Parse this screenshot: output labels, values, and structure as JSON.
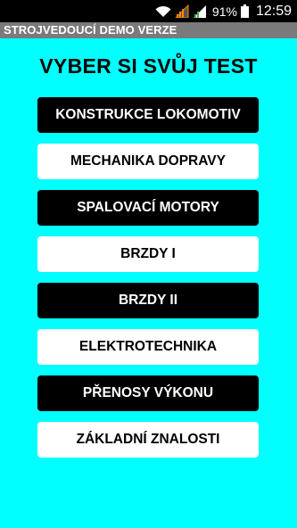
{
  "status_bar": {
    "battery_percent": "91%",
    "time": "12:59",
    "icons": [
      "wifi-icon",
      "signal-icon",
      "signal-icon",
      "battery-icon"
    ]
  },
  "app": {
    "title": "STROJVEDOUCÍ DEMO VERZE"
  },
  "main": {
    "heading": "VYBER SI SVŮJ TEST",
    "tests": [
      {
        "label": "KONSTRUKCE LOKOMOTIV",
        "style": "dark"
      },
      {
        "label": "MECHANIKA DOPRAVY",
        "style": "light"
      },
      {
        "label": "SPALOVACÍ MOTORY",
        "style": "dark"
      },
      {
        "label": "BRZDY I",
        "style": "light"
      },
      {
        "label": "BRZDY II",
        "style": "dark"
      },
      {
        "label": "ELEKTROTECHNIKA",
        "style": "light"
      },
      {
        "label": "PŘENOSY VÝKONU",
        "style": "dark"
      },
      {
        "label": "ZÁKLADNÍ ZNALOSTI",
        "style": "light"
      }
    ]
  },
  "colors": {
    "background": "#00ffff",
    "title_bar": "#7a7a7a",
    "dark_button": "#000000",
    "light_button": "#ffffff",
    "signal_accent": "#ff8800"
  }
}
